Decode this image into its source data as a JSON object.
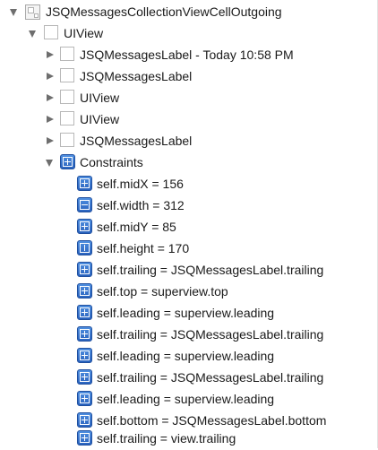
{
  "tree": {
    "root": {
      "label": "JSQMessagesCollectionViewCellOutgoing",
      "icon": "collection-view-cell-icon"
    },
    "content_view": {
      "label": "UIView",
      "icon": "view-icon"
    },
    "children": [
      {
        "label": "JSQMessagesLabel - Today 10:58 PM",
        "icon": "view-icon"
      },
      {
        "label": "JSQMessagesLabel",
        "icon": "view-icon"
      },
      {
        "label": "UIView",
        "icon": "view-icon"
      },
      {
        "label": "UIView",
        "icon": "view-icon"
      },
      {
        "label": "JSQMessagesLabel",
        "icon": "view-icon"
      }
    ],
    "constraints_group": {
      "label": "Constraints",
      "icon": "constraint-icon"
    },
    "constraints": [
      {
        "label": "self.midX = 156",
        "icon": "constraint-icon"
      },
      {
        "label": "self.width = 312",
        "icon": "width-constraint-icon"
      },
      {
        "label": "self.midY = 85",
        "icon": "constraint-icon"
      },
      {
        "label": "self.height = 170",
        "icon": "height-constraint-icon"
      },
      {
        "label": "self.trailing = JSQMessagesLabel.trailing",
        "icon": "constraint-icon"
      },
      {
        "label": "self.top = superview.top",
        "icon": "constraint-icon"
      },
      {
        "label": "self.leading = superview.leading",
        "icon": "constraint-icon"
      },
      {
        "label": "self.trailing = JSQMessagesLabel.trailing",
        "icon": "constraint-icon"
      },
      {
        "label": "self.leading = superview.leading",
        "icon": "constraint-icon"
      },
      {
        "label": "self.trailing = JSQMessagesLabel.trailing",
        "icon": "constraint-icon"
      },
      {
        "label": "self.leading = superview.leading",
        "icon": "constraint-icon"
      },
      {
        "label": "self.bottom = JSQMessagesLabel.bottom",
        "icon": "constraint-icon"
      },
      {
        "label": "self.trailing = view.trailing",
        "icon": "constraint-icon"
      }
    ]
  },
  "colors": {
    "constraint_icon": "#3a78d4",
    "disclosure": "#6e6e6e",
    "text": "#1a1a1a"
  }
}
